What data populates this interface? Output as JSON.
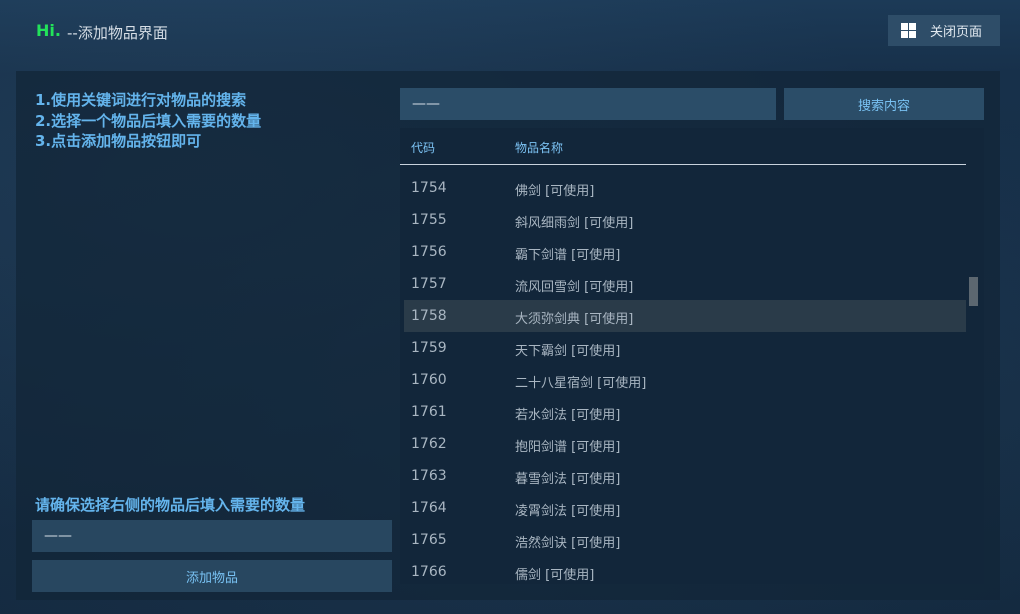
{
  "header": {
    "greeting": "Hi.",
    "title": "--添加物品界面",
    "close_button": "关闭页面"
  },
  "instructions": [
    "1.使用关键词进行对物品的搜索",
    "2.选择一个物品后填入需要的数量",
    "3.点击添加物品按钮即可"
  ],
  "hint": "请确保选择右侧的物品后填入需要的数量",
  "quantity_input": {
    "value": "——"
  },
  "add_button": "添加物品",
  "search": {
    "value": "——",
    "button": "搜索内容"
  },
  "table": {
    "columns": [
      "代码",
      "物品名称"
    ],
    "rows": [
      {
        "code": "1754",
        "name": "佛剑 [可使用]"
      },
      {
        "code": "1755",
        "name": "斜风细雨剑 [可使用]"
      },
      {
        "code": "1756",
        "name": "霸下剑谱 [可使用]"
      },
      {
        "code": "1757",
        "name": "流风回雪剑 [可使用]"
      },
      {
        "code": "1758",
        "name": "大须弥剑典 [可使用]"
      },
      {
        "code": "1759",
        "name": "天下霸剑 [可使用]"
      },
      {
        "code": "1760",
        "name": "二十八星宿剑 [可使用]"
      },
      {
        "code": "1761",
        "name": "若水剑法 [可使用]"
      },
      {
        "code": "1762",
        "name": "抱阳剑谱 [可使用]"
      },
      {
        "code": "1763",
        "name": "暮雪剑法 [可使用]"
      },
      {
        "code": "1764",
        "name": "凌霄剑法 [可使用]"
      },
      {
        "code": "1765",
        "name": "浩然剑诀 [可使用]"
      },
      {
        "code": "1766",
        "name": "儒剑 [可使用]"
      }
    ],
    "selected_code": "1758"
  },
  "colors": {
    "greeting": "#22e35a",
    "instruction_text": "#64b4ec",
    "button_bg": "#284760",
    "selected_row": "#2a3b49"
  },
  "icons": {
    "close_button": "windows-grid-icon"
  }
}
